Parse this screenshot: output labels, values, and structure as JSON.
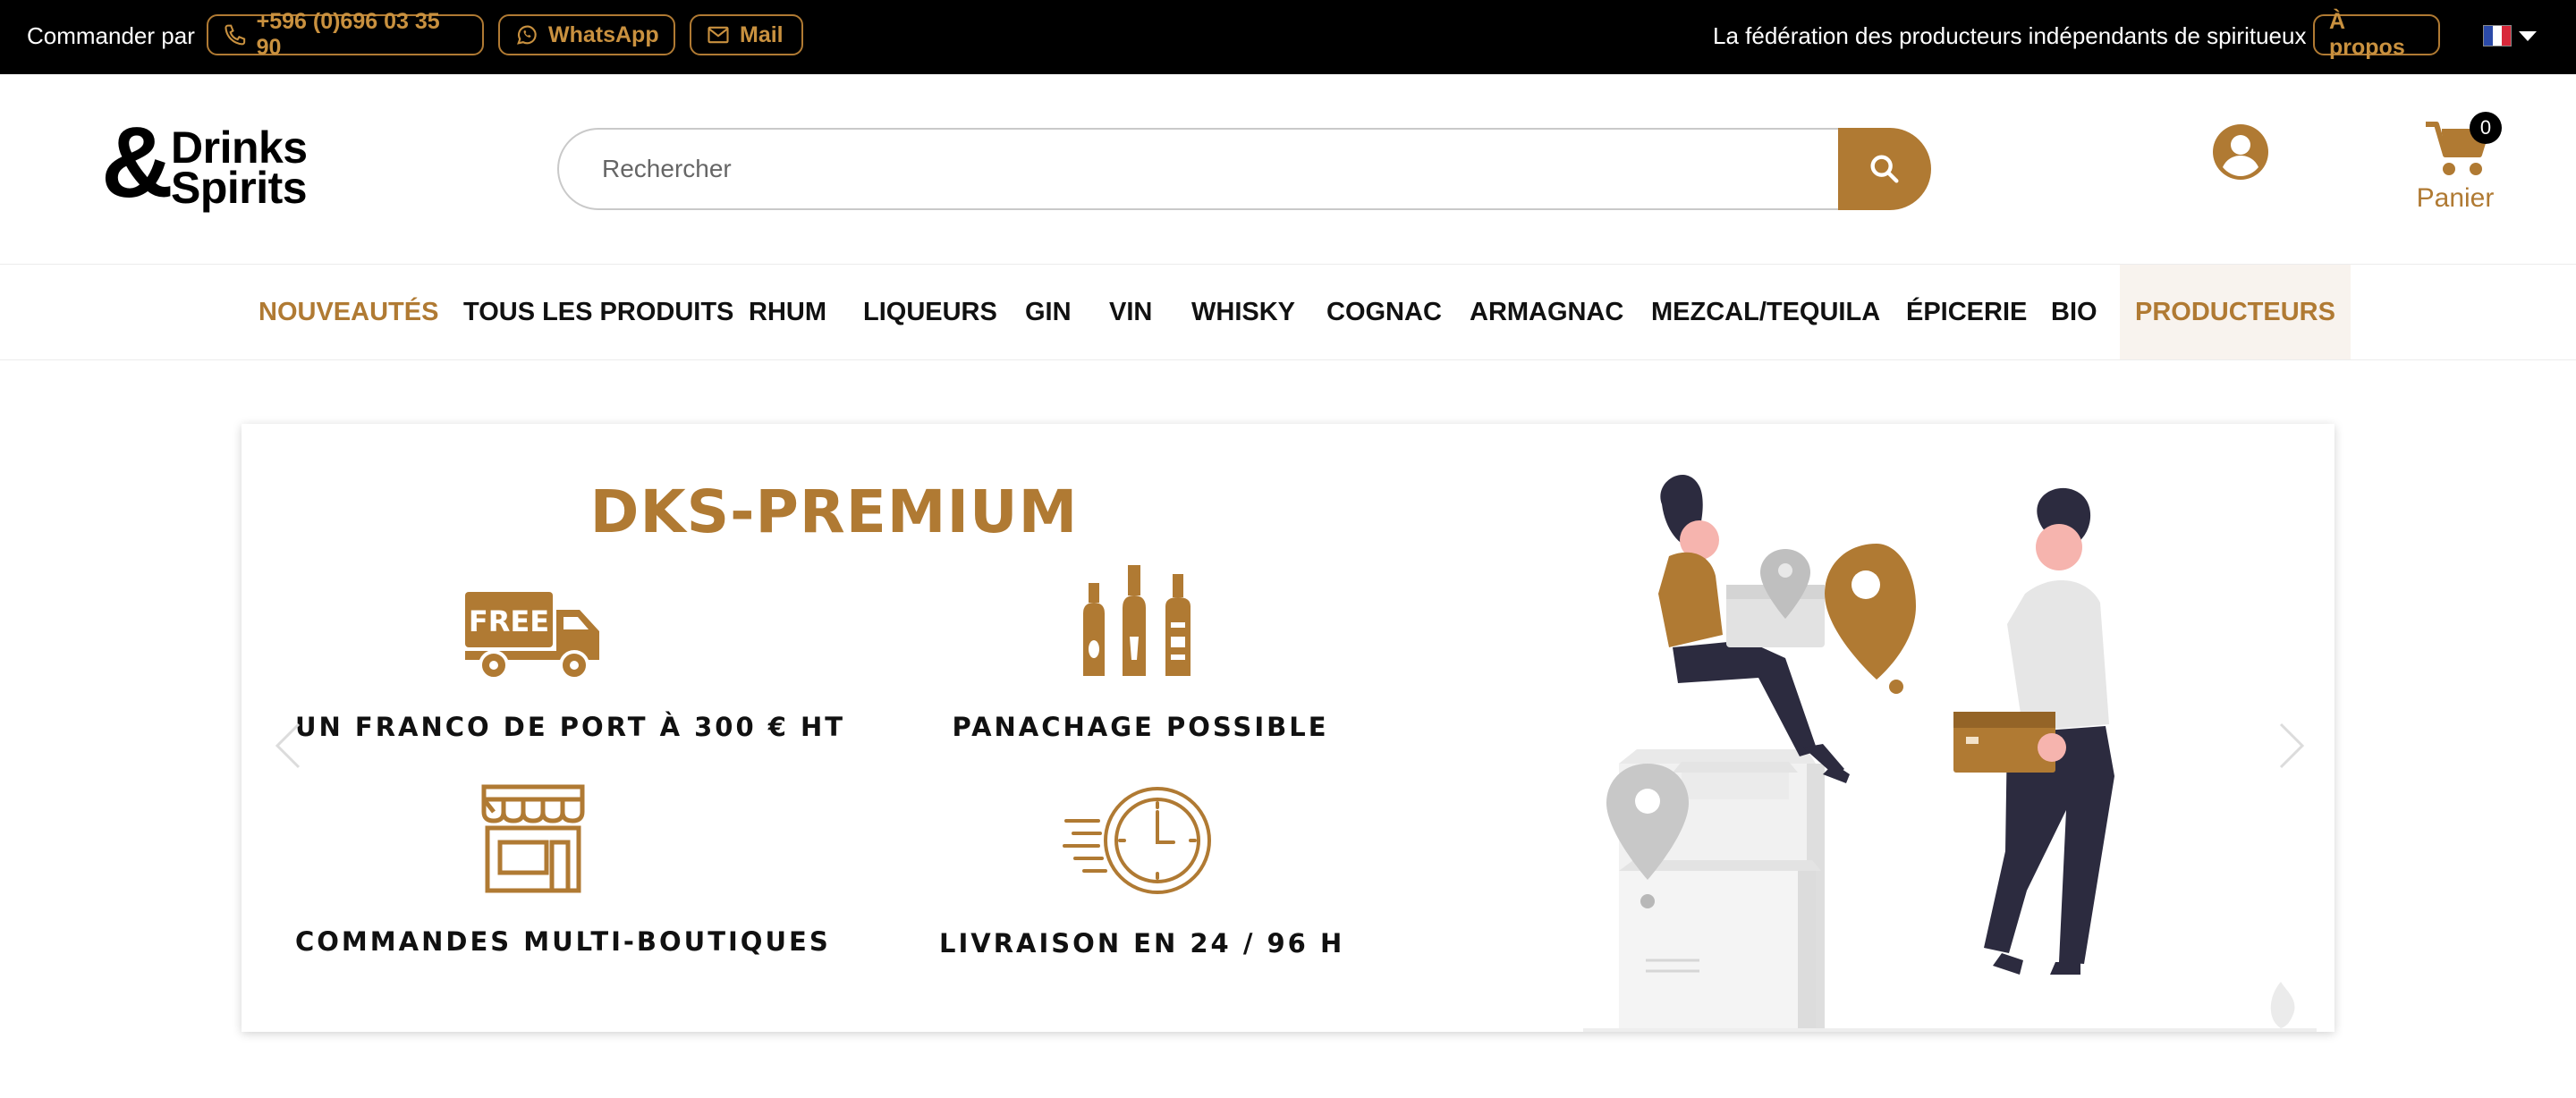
{
  "topbar": {
    "order_label": "Commander par",
    "phone": "+596 (0)696 03 35 90",
    "whatsapp": "WhatsApp",
    "mail": "Mail",
    "federation": "La fédération des producteurs indépendants de spiritueux",
    "about": "À propos",
    "language_icon": "flag-fr-icon"
  },
  "logo": {
    "amp": "&",
    "line1": "Drinks",
    "line2": "Spirits"
  },
  "search": {
    "placeholder": "Rechercher"
  },
  "cart": {
    "count": "0",
    "label": "Panier"
  },
  "nav": {
    "items": [
      "NOUVEAUTÉS",
      "TOUS LES PRODUITS",
      "RHUM",
      "LIQUEURS",
      "GIN",
      "VIN",
      "WHISKY",
      "COGNAC",
      "ARMAGNAC",
      "MEZCAL/TEQUILA",
      "ÉPICERIE",
      "BIO",
      "PRODUCTEURS"
    ]
  },
  "banner": {
    "title": "DKS-PREMIUM",
    "features": [
      {
        "label": "UN FRANCO DE PORT À 300 € HT",
        "icon": "free-truck-icon",
        "icon_text": "FREE"
      },
      {
        "label": "PANACHAGE POSSIBLE",
        "icon": "bottles-icon"
      },
      {
        "label": "COMMANDES MULTI-BOUTIQUES",
        "icon": "shop-icon"
      },
      {
        "label": "LIVRAISON EN 24 / 96 H",
        "icon": "fast-clock-icon"
      }
    ]
  },
  "colors": {
    "accent": "#b07a33",
    "topbar_bg": "#000000",
    "nav_highlight_bg": "#f8f3ee"
  }
}
